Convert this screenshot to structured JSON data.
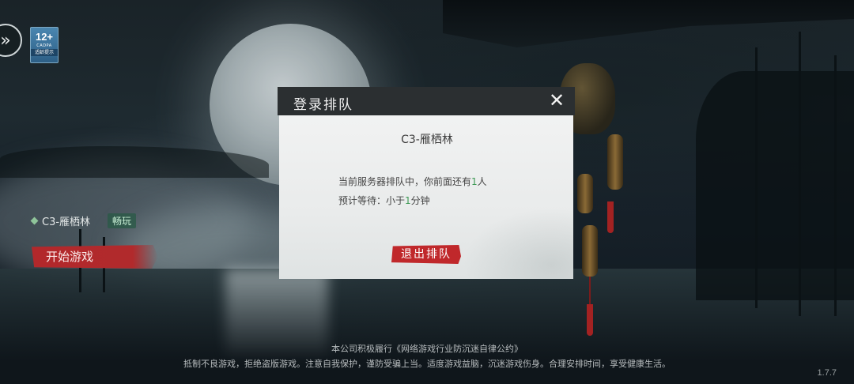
{
  "icons": {
    "back": "double-chevron-icon",
    "close": "close-icon",
    "status": "diamond-icon"
  },
  "age_badge": {
    "age": "12+",
    "org": "CADPA",
    "tip": "适龄提示"
  },
  "server": {
    "name": "C3-雁栖林",
    "status": "畅玩"
  },
  "start_button": "开始游戏",
  "modal": {
    "title": "登录排队",
    "close": "✕",
    "server_name": "C3-雁栖林",
    "line1_prefix": "当前服务器排队中，你前面还有",
    "queue_count": "1",
    "line1_suffix": "人",
    "line2_prefix": "预计等待：小于",
    "wait_minutes": "1",
    "line2_suffix": "分钟",
    "exit_button": "退出排队"
  },
  "footer": {
    "notice1": "本公司积极履行《网络游戏行业防沉迷自律公约》",
    "notice2": "抵制不良游戏，拒绝盗版游戏。注意自我保护，谨防受骗上当。适度游戏益脑，沉迷游戏伤身。合理安排时间，享受健康生活。",
    "version": "1.7.7"
  },
  "colors": {
    "accent_red": "#c0282b",
    "highlight_green": "#3f9a56",
    "status_green": "#8fc49a"
  }
}
